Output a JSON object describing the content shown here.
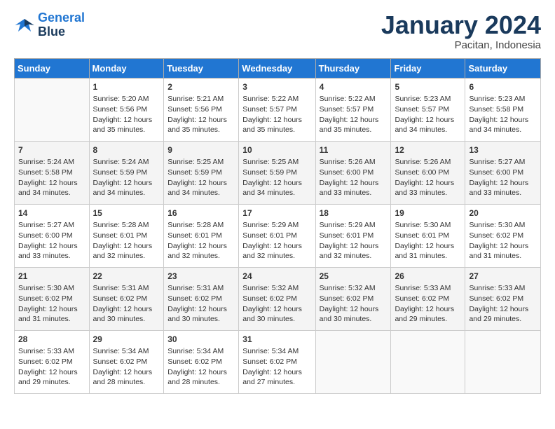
{
  "header": {
    "logo_line1": "General",
    "logo_line2": "Blue",
    "month": "January 2024",
    "location": "Pacitan, Indonesia"
  },
  "weekdays": [
    "Sunday",
    "Monday",
    "Tuesday",
    "Wednesday",
    "Thursday",
    "Friday",
    "Saturday"
  ],
  "weeks": [
    [
      {
        "day": "",
        "info": ""
      },
      {
        "day": "1",
        "info": "Sunrise: 5:20 AM\nSunset: 5:56 PM\nDaylight: 12 hours\nand 35 minutes."
      },
      {
        "day": "2",
        "info": "Sunrise: 5:21 AM\nSunset: 5:56 PM\nDaylight: 12 hours\nand 35 minutes."
      },
      {
        "day": "3",
        "info": "Sunrise: 5:22 AM\nSunset: 5:57 PM\nDaylight: 12 hours\nand 35 minutes."
      },
      {
        "day": "4",
        "info": "Sunrise: 5:22 AM\nSunset: 5:57 PM\nDaylight: 12 hours\nand 35 minutes."
      },
      {
        "day": "5",
        "info": "Sunrise: 5:23 AM\nSunset: 5:57 PM\nDaylight: 12 hours\nand 34 minutes."
      },
      {
        "day": "6",
        "info": "Sunrise: 5:23 AM\nSunset: 5:58 PM\nDaylight: 12 hours\nand 34 minutes."
      }
    ],
    [
      {
        "day": "7",
        "info": "Sunrise: 5:24 AM\nSunset: 5:58 PM\nDaylight: 12 hours\nand 34 minutes."
      },
      {
        "day": "8",
        "info": "Sunrise: 5:24 AM\nSunset: 5:59 PM\nDaylight: 12 hours\nand 34 minutes."
      },
      {
        "day": "9",
        "info": "Sunrise: 5:25 AM\nSunset: 5:59 PM\nDaylight: 12 hours\nand 34 minutes."
      },
      {
        "day": "10",
        "info": "Sunrise: 5:25 AM\nSunset: 5:59 PM\nDaylight: 12 hours\nand 34 minutes."
      },
      {
        "day": "11",
        "info": "Sunrise: 5:26 AM\nSunset: 6:00 PM\nDaylight: 12 hours\nand 33 minutes."
      },
      {
        "day": "12",
        "info": "Sunrise: 5:26 AM\nSunset: 6:00 PM\nDaylight: 12 hours\nand 33 minutes."
      },
      {
        "day": "13",
        "info": "Sunrise: 5:27 AM\nSunset: 6:00 PM\nDaylight: 12 hours\nand 33 minutes."
      }
    ],
    [
      {
        "day": "14",
        "info": "Sunrise: 5:27 AM\nSunset: 6:00 PM\nDaylight: 12 hours\nand 33 minutes."
      },
      {
        "day": "15",
        "info": "Sunrise: 5:28 AM\nSunset: 6:01 PM\nDaylight: 12 hours\nand 32 minutes."
      },
      {
        "day": "16",
        "info": "Sunrise: 5:28 AM\nSunset: 6:01 PM\nDaylight: 12 hours\nand 32 minutes."
      },
      {
        "day": "17",
        "info": "Sunrise: 5:29 AM\nSunset: 6:01 PM\nDaylight: 12 hours\nand 32 minutes."
      },
      {
        "day": "18",
        "info": "Sunrise: 5:29 AM\nSunset: 6:01 PM\nDaylight: 12 hours\nand 32 minutes."
      },
      {
        "day": "19",
        "info": "Sunrise: 5:30 AM\nSunset: 6:01 PM\nDaylight: 12 hours\nand 31 minutes."
      },
      {
        "day": "20",
        "info": "Sunrise: 5:30 AM\nSunset: 6:02 PM\nDaylight: 12 hours\nand 31 minutes."
      }
    ],
    [
      {
        "day": "21",
        "info": "Sunrise: 5:30 AM\nSunset: 6:02 PM\nDaylight: 12 hours\nand 31 minutes."
      },
      {
        "day": "22",
        "info": "Sunrise: 5:31 AM\nSunset: 6:02 PM\nDaylight: 12 hours\nand 30 minutes."
      },
      {
        "day": "23",
        "info": "Sunrise: 5:31 AM\nSunset: 6:02 PM\nDaylight: 12 hours\nand 30 minutes."
      },
      {
        "day": "24",
        "info": "Sunrise: 5:32 AM\nSunset: 6:02 PM\nDaylight: 12 hours\nand 30 minutes."
      },
      {
        "day": "25",
        "info": "Sunrise: 5:32 AM\nSunset: 6:02 PM\nDaylight: 12 hours\nand 30 minutes."
      },
      {
        "day": "26",
        "info": "Sunrise: 5:33 AM\nSunset: 6:02 PM\nDaylight: 12 hours\nand 29 minutes."
      },
      {
        "day": "27",
        "info": "Sunrise: 5:33 AM\nSunset: 6:02 PM\nDaylight: 12 hours\nand 29 minutes."
      }
    ],
    [
      {
        "day": "28",
        "info": "Sunrise: 5:33 AM\nSunset: 6:02 PM\nDaylight: 12 hours\nand 29 minutes."
      },
      {
        "day": "29",
        "info": "Sunrise: 5:34 AM\nSunset: 6:02 PM\nDaylight: 12 hours\nand 28 minutes."
      },
      {
        "day": "30",
        "info": "Sunrise: 5:34 AM\nSunset: 6:02 PM\nDaylight: 12 hours\nand 28 minutes."
      },
      {
        "day": "31",
        "info": "Sunrise: 5:34 AM\nSunset: 6:02 PM\nDaylight: 12 hours\nand 27 minutes."
      },
      {
        "day": "",
        "info": ""
      },
      {
        "day": "",
        "info": ""
      },
      {
        "day": "",
        "info": ""
      }
    ]
  ]
}
